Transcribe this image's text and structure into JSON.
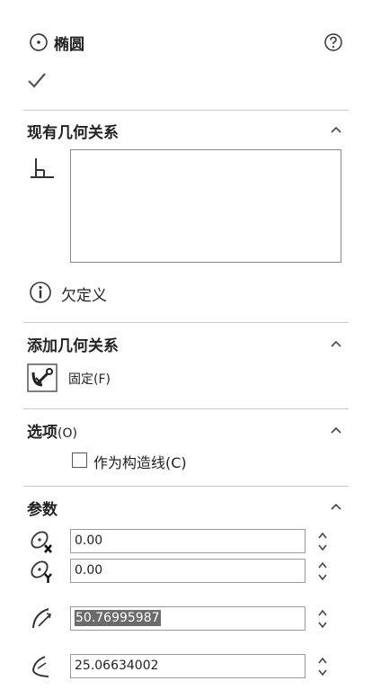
{
  "header": {
    "title": "椭圆",
    "help_icon": "help-circle-icon",
    "confirm_icon": "checkmark-icon"
  },
  "existing_relations": {
    "title": "现有几何关系",
    "status_text": "欠定义"
  },
  "add_relations": {
    "title": "添加几何关系",
    "fix_label": "固定(F)"
  },
  "options": {
    "title": "选项",
    "title_suffix": "(O)",
    "construction_label": "作为构造线(C)",
    "construction_checked": false
  },
  "parameters": {
    "title": "参数",
    "center_x": "0.00",
    "center_y": "0.00",
    "radius_1": "50.76995987",
    "radius_2": "25.06634002"
  }
}
